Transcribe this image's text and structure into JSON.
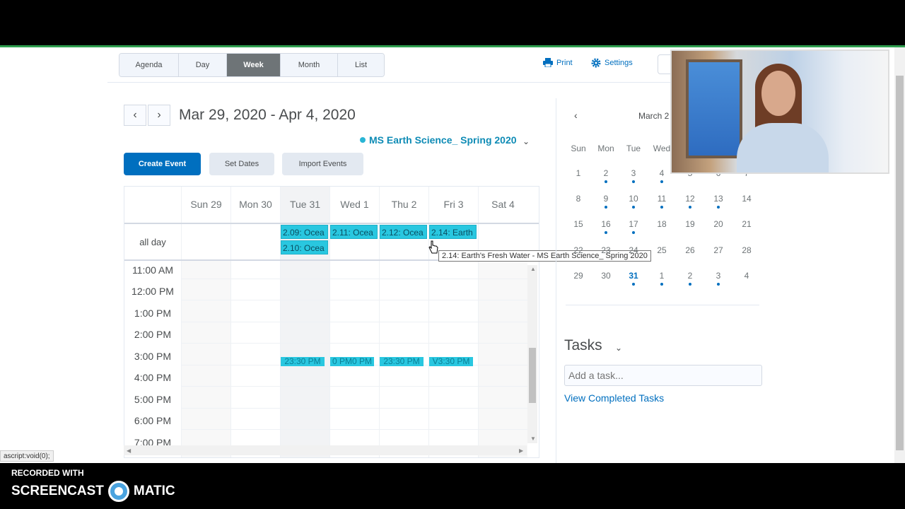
{
  "view_tabs": [
    {
      "label": "Agenda",
      "active": false
    },
    {
      "label": "Day",
      "active": false
    },
    {
      "label": "Week",
      "active": true
    },
    {
      "label": "Month",
      "active": false
    },
    {
      "label": "List",
      "active": false
    }
  ],
  "toolbar": {
    "print_label": "Print",
    "settings_label": "Settings"
  },
  "date_range": "Mar 29, 2020 - Apr 4, 2020",
  "calendar_name": "MS Earth Science_ Spring 2020",
  "buttons": {
    "create_event": "Create Event",
    "set_dates": "Set Dates",
    "import_events": "Import Events"
  },
  "week_days": [
    "Sun 29",
    "Mon 30",
    "Tue 31",
    "Wed 1",
    "Thu 2",
    "Fri 3",
    "Sat 4"
  ],
  "all_day_label": "all day",
  "all_day_events": [
    {
      "day": "Tue 31",
      "label": "2.09: Ocea"
    },
    {
      "day": "Tue 31",
      "label": "2.10: Ocea"
    },
    {
      "day": "Wed 1",
      "label": "2.11: Ocea"
    },
    {
      "day": "Thu 2",
      "label": "2.12: Ocea"
    },
    {
      "day": "Fri 3",
      "label": "2.14: Earth"
    }
  ],
  "time_slots": [
    "11:00 AM",
    "12:00 PM",
    "1:00 PM",
    "2:00 PM",
    "3:00 PM",
    "4:00 PM",
    "5:00 PM",
    "6:00 PM",
    "7:00 PM"
  ],
  "timed_events": [
    {
      "day": "Tue 31",
      "label": "23:30 PM"
    },
    {
      "day": "Wed 1",
      "label": "0 PM0 PM"
    },
    {
      "day": "Thu 2",
      "label": "23:30 PM"
    },
    {
      "day": "Fri 3",
      "label": "V3:30 PM"
    }
  ],
  "tooltip": "2.14: Earth's Fresh Water - MS Earth Science_ Spring 2020",
  "mini_calendar": {
    "title": "March 2",
    "dow": [
      "Sun",
      "Mon",
      "Tue",
      "Wed"
    ],
    "weeks": [
      [
        {
          "d": "1",
          "dot": false
        },
        {
          "d": "2",
          "dot": true
        },
        {
          "d": "3",
          "dot": true
        },
        {
          "d": "4",
          "dot": true
        },
        {
          "d": "5",
          "dot": false
        },
        {
          "d": "6",
          "dot": false
        },
        {
          "d": "7",
          "dot": false
        }
      ],
      [
        {
          "d": "8",
          "dot": false
        },
        {
          "d": "9",
          "dot": true
        },
        {
          "d": "10",
          "dot": true
        },
        {
          "d": "11",
          "dot": true
        },
        {
          "d": "12",
          "dot": true
        },
        {
          "d": "13",
          "dot": true
        },
        {
          "d": "14",
          "dot": false
        }
      ],
      [
        {
          "d": "15",
          "dot": false
        },
        {
          "d": "16",
          "dot": true
        },
        {
          "d": "17",
          "dot": true
        },
        {
          "d": "18",
          "dot": false
        },
        {
          "d": "19",
          "dot": false
        },
        {
          "d": "20",
          "dot": false
        },
        {
          "d": "21",
          "dot": false
        }
      ],
      [
        {
          "d": "22",
          "dot": false
        },
        {
          "d": "23",
          "dot": false
        },
        {
          "d": "24",
          "dot": false
        },
        {
          "d": "25",
          "dot": false
        },
        {
          "d": "26",
          "dot": false
        },
        {
          "d": "27",
          "dot": false
        },
        {
          "d": "28",
          "dot": false
        }
      ],
      [
        {
          "d": "29",
          "dot": false
        },
        {
          "d": "30",
          "dot": false
        },
        {
          "d": "31",
          "dot": true,
          "today": true
        },
        {
          "d": "1",
          "dot": true
        },
        {
          "d": "2",
          "dot": true
        },
        {
          "d": "3",
          "dot": true
        },
        {
          "d": "4",
          "dot": false
        }
      ]
    ]
  },
  "tasks": {
    "title": "Tasks",
    "placeholder": "Add a task...",
    "view_completed": "View Completed Tasks"
  },
  "status_url": "ascript:void(0);",
  "watermark": {
    "line1": "RECORDED WITH",
    "line2a": "SCREENCAST",
    "line2b": "MATIC"
  },
  "colors": {
    "accent": "#006fbf",
    "event": "#29c7e0",
    "active_tab": "#6e7477"
  }
}
